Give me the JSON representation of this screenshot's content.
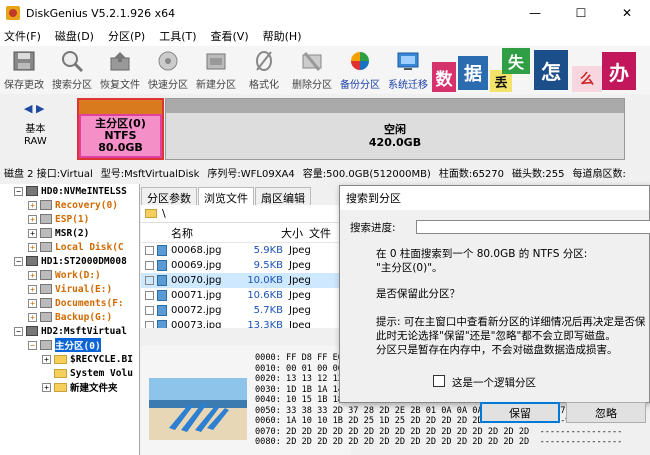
{
  "window": {
    "title": "DiskGenius V5.2.1.926 x64",
    "minimize": "—",
    "maximize": "☐",
    "close": "✕"
  },
  "menu": [
    "文件(F)",
    "磁盘(D)",
    "分区(P)",
    "工具(T)",
    "查看(V)",
    "帮助(H)"
  ],
  "toolbar": [
    {
      "label": "保存更改",
      "icon": "save-icon"
    },
    {
      "label": "搜索分区",
      "icon": "search-icon"
    },
    {
      "label": "恢复文件",
      "icon": "recover-icon"
    },
    {
      "label": "快速分区",
      "icon": "quick-partition-icon"
    },
    {
      "label": "新建分区",
      "icon": "new-partition-icon"
    },
    {
      "label": "格式化",
      "icon": "format-icon"
    },
    {
      "label": "删除分区",
      "icon": "delete-partition-icon"
    },
    {
      "label": "备份分区",
      "icon": "backup-icon"
    },
    {
      "label": "系统迁移",
      "icon": "migrate-icon"
    }
  ],
  "ad": {
    "chars": [
      "数",
      "据",
      "丢",
      "失",
      "怎",
      "么",
      "办"
    ],
    "colors": [
      "#d6336c",
      "#2b6cb0",
      "#111111",
      "#2f9e44",
      "#1c4f8a",
      "#cc2222",
      "#c2185b"
    ]
  },
  "disk_nav": {
    "prev": "◀",
    "next": "▶",
    "type": "基本",
    "style": "RAW"
  },
  "partitions": [
    {
      "name": "主分区(0)",
      "fs": "NTFS",
      "size": "80.0GB"
    },
    {
      "name": "空闲",
      "size": "420.0GB"
    }
  ],
  "info": [
    "磁盘 2 接口:Virtual",
    "型号:MsftVirtualDisk",
    "序列号:WFL09XA4",
    "容量:500.0GB(512000MB)",
    "柱面数:65270",
    "磁头数:255",
    "每道扇区数:"
  ],
  "tree": [
    {
      "text": "HD0:NVMeINTELSS",
      "level": 0,
      "exp": "−",
      "kind": "disk",
      "color": "black"
    },
    {
      "text": "Recovery(0)",
      "level": 1,
      "exp": "+",
      "kind": "part",
      "color": "orange"
    },
    {
      "text": "ESP(1)",
      "level": 1,
      "exp": "+",
      "kind": "part",
      "color": "orange"
    },
    {
      "text": "MSR(2)",
      "level": 1,
      "exp": "+",
      "kind": "part",
      "color": "black"
    },
    {
      "text": "Local Disk(C",
      "level": 1,
      "exp": "+",
      "kind": "part",
      "color": "orange"
    },
    {
      "text": "HD1:ST2000DM008",
      "level": 0,
      "exp": "−",
      "kind": "disk",
      "color": "black"
    },
    {
      "text": "Work(D:)",
      "level": 1,
      "exp": "+",
      "kind": "part",
      "color": "orange"
    },
    {
      "text": "Virual(E:)",
      "level": 1,
      "exp": "+",
      "kind": "part",
      "color": "orange"
    },
    {
      "text": "Documents(F:",
      "level": 1,
      "exp": "+",
      "kind": "part",
      "color": "orange"
    },
    {
      "text": "Backup(G:)",
      "level": 1,
      "exp": "+",
      "kind": "part",
      "color": "orange"
    },
    {
      "text": "HD2:MsftVirtual",
      "level": 0,
      "exp": "−",
      "kind": "disk",
      "color": "black"
    },
    {
      "text": "主分区(0)",
      "level": 1,
      "exp": "−",
      "kind": "part",
      "color": "orange",
      "selected": true
    },
    {
      "text": "$RECYCLE.BI",
      "level": 2,
      "exp": "+",
      "kind": "folder",
      "color": "black"
    },
    {
      "text": "System Volu",
      "level": 2,
      "exp": "",
      "kind": "folder",
      "color": "black"
    },
    {
      "text": "新建文件夹",
      "level": 2,
      "exp": "+",
      "kind": "folder",
      "color": "black"
    }
  ],
  "tabs": [
    "分区参数",
    "浏览文件",
    "扇区编辑"
  ],
  "path": "\\",
  "file_headers": {
    "name": "名称",
    "size": "大小",
    "type": "文件"
  },
  "files": [
    {
      "name": "00068.jpg",
      "size": "5.9KB",
      "type": "Jpeg"
    },
    {
      "name": "00069.jpg",
      "size": "9.5KB",
      "type": "Jpeg"
    },
    {
      "name": "00070.jpg",
      "size": "10.0KB",
      "type": "Jpeg",
      "selected": true
    },
    {
      "name": "00071.jpg",
      "size": "10.6KB",
      "type": "Jpeg"
    },
    {
      "name": "00072.jpg",
      "size": "5.7KB",
      "type": "Jpeg"
    },
    {
      "name": "00073.jpg",
      "size": "13.3KB",
      "type": "Jpeg"
    }
  ],
  "hex_lines": [
    "0000: FF D8 FF E0 00 10 4A 46 49 46 00 01 01 01 00 48  ......JFIF.....H",
    "0010: 00 01 00 00 FF E1 00 16 45 78 69 66 00 00 4D 4D  ........Exif..MM",
    "0020: 13 13 12 13 14 15 16 17 18 19 1A 1B 1C 1D 1E 1F  ................",
    "0030: 1D 1B 1A 14 15 10 20 17 1B 1B 1C 1D 1E 1F 20 21  ...... ........ !",
    "0040: 10 15 1B 18 1E 22 24 2F 4E 0D 0A 0A 0A 0E 01 04  .....\"$/N.......",
    "0050: 33 38 33 2D 37 28 2D 2E 2B 01 0A 0A 0A 0E 0D 0E  383-7(-.+.......",
    "0060: 1A 10 10 1B 2D 25 1D 25 2D 2D 2D 2D 2D 2D 2D 2D  ....-%.%--------",
    "0070: 2D 2D 2D 2D 2D 2D 2D 2D 2D 2D 2D 2D 2D 2D 2D 2D  ----------------",
    "0080: 2D 2D 2D 2D 2D 2D 2D 2D 2D 2D 2D 2D 2D 2D 2D 2D  ----------------"
  ],
  "dialog": {
    "title": "搜索到分区",
    "progress_label": "搜索进度:",
    "message1": "在 0 柱面搜索到一个 80.0GB 的 NTFS 分区:",
    "message2": "\"主分区(0)\"。",
    "question": "是否保留此分区？",
    "hint1": "提示: 可在主窗口中查看新分区的详细情况后再决定是否保",
    "hint2": "此时无论选择\"保留\"还是\"忽略\"都不会立即写磁盘。",
    "hint3": "分区只是暂存在内存中，不会对磁盘数据造成损害。",
    "checkbox": "这是一个逻辑分区",
    "keep": "保留",
    "ignore": "忽略"
  }
}
